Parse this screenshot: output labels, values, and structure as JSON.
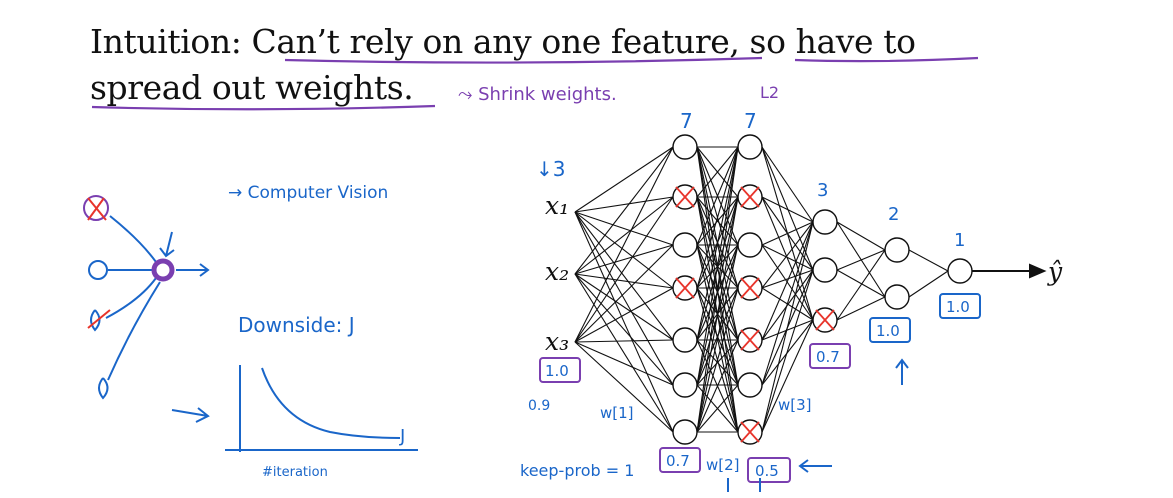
{
  "slide": {
    "title_line1": "Intuition: Can’t rely on any one feature, so have to",
    "title_line2": "spread out weights."
  },
  "annotations": {
    "shrink_weights": "⤳ Shrink weights.",
    "l2": "L2",
    "computer_vision": "→ Computer Vision",
    "downside": "Downside: J",
    "cost_curve_label": "J",
    "iteration_label": "#iteration",
    "down_arrow_3": "↓3",
    "keep_prob": "keep-prob = 1",
    "w1": "w[1]",
    "w2": "w[2]",
    "w3": "w[3]",
    "p_in": "0.9"
  },
  "network": {
    "inputs": [
      "x₁",
      "x₂",
      "x₃"
    ],
    "output": "ŷ",
    "layer_sizes": [
      "7",
      "7",
      "3",
      "2",
      "1"
    ],
    "keep_probs": [
      "1.0",
      "0.7",
      "0.5",
      "0.7",
      "1.0",
      "1.0"
    ],
    "colors": {
      "ink": "#111111",
      "blue": "#1a66c9",
      "purple": "#7a3fb0",
      "red": "#e8342b"
    }
  }
}
